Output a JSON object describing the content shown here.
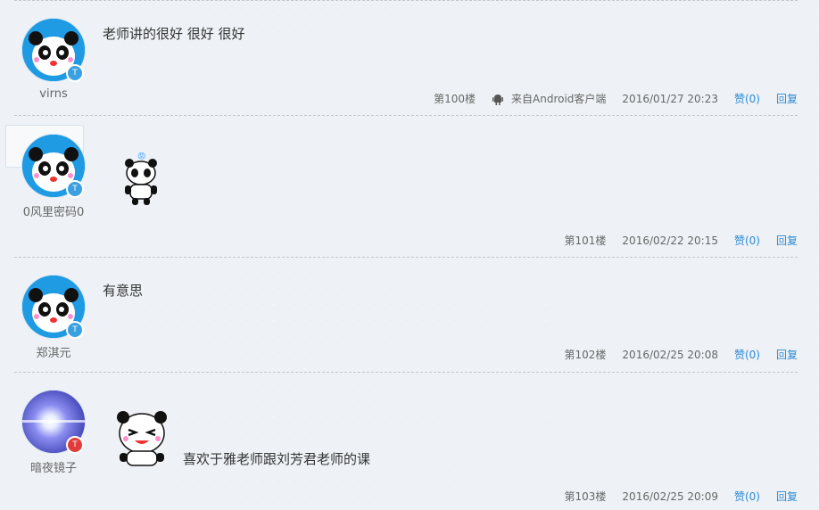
{
  "posts": [
    {
      "username": "virns",
      "content": "老师讲的很好 很好 很好",
      "floor": "第100楼",
      "source": "来自Android客户端",
      "time": "2016/01/27 20:23",
      "like": "赞(0)",
      "reply": "回复",
      "avatar_icon": "panda-avatar",
      "badge_color": "#3aa0e0"
    },
    {
      "username": "0风里密码0",
      "content": "",
      "emoji": "panda-emoji",
      "floor": "第101楼",
      "time": "2016/02/22 20:15",
      "like": "赞(0)",
      "reply": "回复",
      "avatar_icon": "panda-avatar",
      "badge_color": "#3aa0e0"
    },
    {
      "username": "郑淇元",
      "content": "有意思",
      "floor": "第102楼",
      "time": "2016/02/25 20:08",
      "like": "赞(0)",
      "reply": "回复",
      "avatar_icon": "panda-avatar",
      "badge_color": "#3aa0e0"
    },
    {
      "username": "暗夜镜子",
      "content": "喜欢于雅老师跟刘芳君老师的课",
      "emoji": "panda-emoji-laugh",
      "floor": "第103楼",
      "time": "2016/02/25 20:09",
      "like": "赞(0)",
      "reply": "回复",
      "avatar_icon": "light-flare-avatar",
      "badge_color": "#e23b3b"
    }
  ]
}
